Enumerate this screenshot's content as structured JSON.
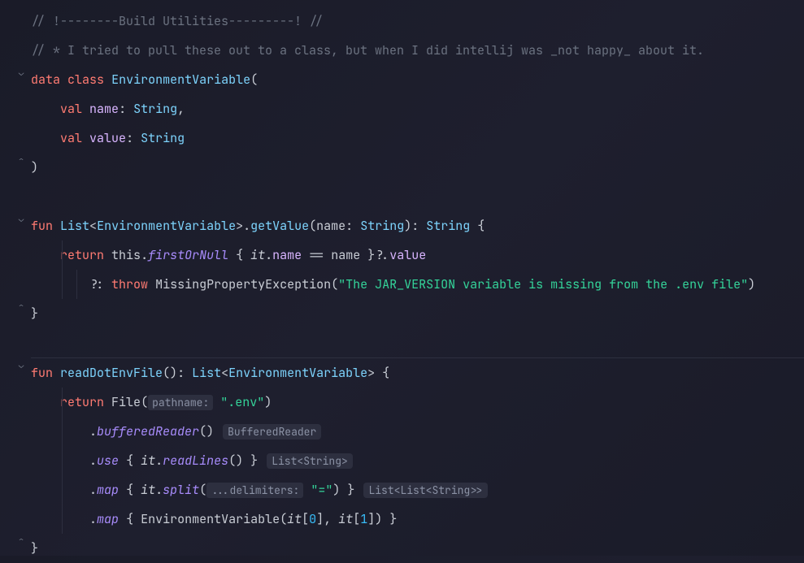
{
  "comments": {
    "header": "// !--------Build Utilities---------! //",
    "note": "// * I tried to pull these out to a class, but when I did intellij was _not happy_ about it."
  },
  "kw": {
    "data": "data",
    "class": "class",
    "val": "val",
    "fun": "fun",
    "return": "return",
    "this": "this",
    "throw": "throw"
  },
  "types": {
    "EnvironmentVariable": "EnvironmentVariable",
    "String": "String",
    "List": "List",
    "File": "File",
    "BufferedReader": "BufferedReader",
    "ListString": "List<String>",
    "ListListString": "List<List<String>>",
    "MissingPropertyException": "MissingPropertyException"
  },
  "props": {
    "name": "name",
    "value": "value"
  },
  "funcs": {
    "getValue": "getValue",
    "readDotEnvFile": "readDotEnvFile",
    "firstOrNull": "firstOrNull",
    "bufferedReader": "bufferedReader",
    "use": "use",
    "readLines": "readLines",
    "map": "map",
    "split": "split"
  },
  "idents": {
    "it": "it",
    "name": "name"
  },
  "strings": {
    "missing": "\"The JAR_VERSION variable is missing from the .env file\"",
    "dotenv": "\".env\"",
    "eq": "\"=\""
  },
  "hints": {
    "pathname": "pathname:",
    "delimiters": "...delimiters:"
  },
  "nums": {
    "zero": "0",
    "one": "1"
  },
  "punct": {
    "lparen": "(",
    "rparen": ")",
    "lbrace": "{",
    "rbrace": "}",
    "lbracket": "[",
    "rbracket": "]",
    "lt": "<",
    "gt": ">",
    "colon": ":",
    "comma": ",",
    "dot": ".",
    "eqeq": "==",
    "qdot": "?.",
    "elvis": "?:",
    "empty_parens": "()"
  }
}
